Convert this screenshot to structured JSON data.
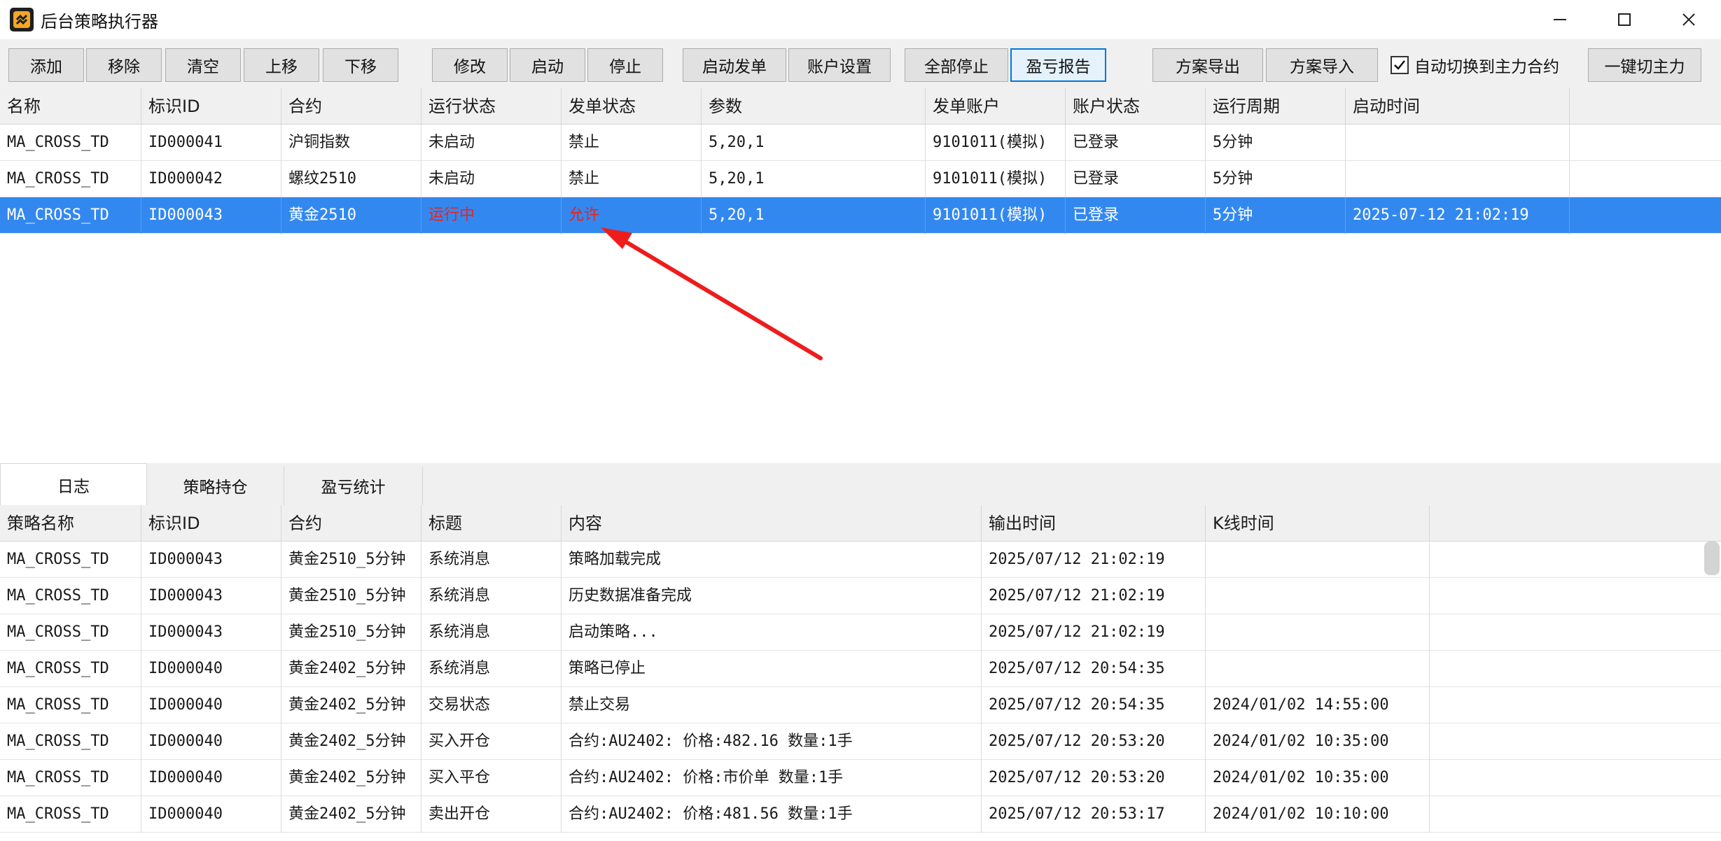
{
  "window": {
    "title": "后台策略执行器",
    "icon": "app-logo-icon",
    "controls": {
      "minimize": "—",
      "maximize": "☐",
      "close": "✕"
    }
  },
  "toolbar": {
    "buttons": [
      {
        "label": "添加"
      },
      {
        "label": "移除"
      },
      {
        "label": "清空"
      },
      {
        "label": "上移"
      },
      {
        "label": "下移"
      },
      {
        "label": "修改"
      },
      {
        "label": "启动"
      },
      {
        "label": "停止"
      },
      {
        "label": "启动发单"
      },
      {
        "label": "账户设置"
      },
      {
        "label": "全部停止"
      },
      {
        "label": "盈亏报告"
      },
      {
        "label": "方案导出"
      },
      {
        "label": "方案导入"
      },
      {
        "label": "一键切主力"
      }
    ],
    "checkbox": {
      "label": "自动切换到主力合约",
      "checked": true
    }
  },
  "strategies": {
    "columns": [
      "名称",
      "标识ID",
      "合约",
      "运行状态",
      "发单状态",
      "参数",
      "发单账户",
      "账户状态",
      "运行周期",
      "启动时间"
    ],
    "rows": [
      [
        "MA_CROSS_TD",
        "ID000041",
        "沪铜指数",
        "未启动",
        "禁止",
        "5,20,1",
        "9101011(模拟)",
        "已登录",
        "5分钟",
        ""
      ],
      [
        "MA_CROSS_TD",
        "ID000042",
        "螺纹2510",
        "未启动",
        "禁止",
        "5,20,1",
        "9101011(模拟)",
        "已登录",
        "5分钟",
        ""
      ],
      [
        "MA_CROSS_TD",
        "ID000043",
        "黄金2510",
        "运行中",
        "允许",
        "5,20,1",
        "9101011(模拟)",
        "已登录",
        "5分钟",
        "2025-07-12 21:02:19"
      ]
    ],
    "selected_row": 2
  },
  "tabs": [
    {
      "label": "日志",
      "active": true
    },
    {
      "label": "策略持仓",
      "active": false
    },
    {
      "label": "盈亏统计",
      "active": false
    }
  ],
  "log": {
    "columns": [
      "策略名称",
      "标识ID",
      "合约",
      "标题",
      "内容",
      "输出时间",
      "K线时间"
    ],
    "rows": [
      [
        "MA_CROSS_TD",
        "ID000043",
        "黄金2510_5分钟",
        "系统消息",
        "策略加载完成",
        "2025/07/12 21:02:19",
        ""
      ],
      [
        "MA_CROSS_TD",
        "ID000043",
        "黄金2510_5分钟",
        "系统消息",
        "历史数据准备完成",
        "2025/07/12 21:02:19",
        ""
      ],
      [
        "MA_CROSS_TD",
        "ID000043",
        "黄金2510_5分钟",
        "系统消息",
        "启动策略...",
        "2025/07/12 21:02:19",
        ""
      ],
      [
        "MA_CROSS_TD",
        "ID000040",
        "黄金2402_5分钟",
        "系统消息",
        "策略已停止",
        "2025/07/12 20:54:35",
        ""
      ],
      [
        "MA_CROSS_TD",
        "ID000040",
        "黄金2402_5分钟",
        "交易状态",
        "禁止交易",
        "2025/07/12 20:54:35",
        "2024/01/02 14:55:00"
      ],
      [
        "MA_CROSS_TD",
        "ID000040",
        "黄金2402_5分钟",
        "买入开仓",
        "合约:AU2402: 价格:482.16 数量:1手",
        "2025/07/12 20:53:20",
        "2024/01/02 10:35:00"
      ],
      [
        "MA_CROSS_TD",
        "ID000040",
        "黄金2402_5分钟",
        "买入平仓",
        "合约:AU2402: 价格:市价单 数量:1手",
        "2025/07/12 20:53:20",
        "2024/01/02 10:35:00"
      ],
      [
        "MA_CROSS_TD",
        "ID000040",
        "黄金2402_5分钟",
        "卖出开仓",
        "合约:AU2402: 价格:481.56 数量:1手",
        "2025/07/12 20:53:17",
        "2024/01/02 10:10:00"
      ]
    ]
  },
  "colors": {
    "selection": "#3388f0",
    "highlight_text": "#e8231e",
    "arrow": "#ee1c1c"
  }
}
